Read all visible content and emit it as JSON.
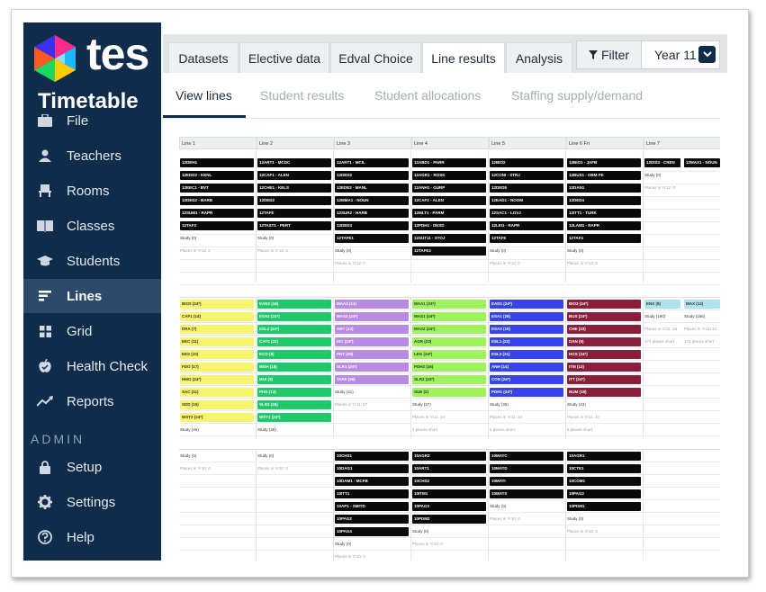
{
  "app": {
    "logo_text": "tes",
    "product": "Timetable"
  },
  "sidebar": {
    "items": [
      {
        "label": "File",
        "icon": "briefcase-icon"
      },
      {
        "label": "Teachers",
        "icon": "person-icon"
      },
      {
        "label": "Rooms",
        "icon": "chair-icon"
      },
      {
        "label": "Classes",
        "icon": "book-icon"
      },
      {
        "label": "Students",
        "icon": "graduation-cap-icon"
      },
      {
        "label": "Lines",
        "icon": "lines-icon"
      },
      {
        "label": "Grid",
        "icon": "grid-icon"
      },
      {
        "label": "Health Check",
        "icon": "apple-check-icon"
      },
      {
        "label": "Reports",
        "icon": "trend-icon"
      }
    ],
    "admin_label": "ADMIN",
    "admin_items": [
      {
        "label": "Setup",
        "icon": "lock-icon"
      },
      {
        "label": "Settings",
        "icon": "gear-icon"
      },
      {
        "label": "Help",
        "icon": "help-icon"
      }
    ]
  },
  "tabs": [
    "Datasets",
    "Elective data",
    "Edval Choice",
    "Line results",
    "Analysis"
  ],
  "active_tab": "Line results",
  "filter": {
    "label": "Filter",
    "year": "Year 11"
  },
  "subtabs": [
    "View lines",
    "Student results",
    "Student allocations",
    "Staffing supply/demand"
  ],
  "headers": [
    "Line 1",
    "Line 2",
    "Line 3",
    "Line 4",
    "Line 5",
    "Line 6  Fri",
    "Line 7"
  ],
  "colors": {
    "sidebar": "#102c4b",
    "black": "#0a0a0a",
    "yellow": "#f7f36a",
    "green": "#1dc96a",
    "purple": "#b98ae3",
    "lightgreen": "#9ef25c",
    "blue": "#3542ee",
    "maroon": "#8a1f3b",
    "cyan": "#aee3ed"
  },
  "block1": {
    "cols": [
      {
        "boxes": [
          "12DEH1",
          "12EDD2 - KENL",
          "12EEC1 - BVT",
          "12DED2 - BARB",
          "12SUM1 - RAPR",
          "12TAF3"
        ],
        "study": "Study (0)",
        "places": "Places in Yr12: 0"
      },
      {
        "boxes": [
          "12ART1 - MCDC",
          "12CAF1 - ALEN",
          "12CHE1 - KELS",
          "12DED2",
          "12TAFE",
          "12TAST1 - PERT"
        ],
        "study": "Study (0)",
        "places": "Places in Yr12: 0"
      },
      {
        "boxes": [
          "12ART1 - MCIL",
          "12DED2",
          "12EDE2 - MANL",
          "12MMA1 - NOUN",
          "12SUR2 - HARB",
          "12DED3",
          "12TAFE1"
        ],
        "study": "Study (0)",
        "places": "Places in Yr12: 0"
      },
      {
        "boxes": [
          "12ABD1 - PARR",
          "12AGR1 - ROSK",
          "12ANH1 - GURP",
          "12CAF2 - ALEN",
          "12MLT1 - PARM",
          "12PDH1 - DESD",
          "12SUT11 - STOJ",
          "12TAFE2"
        ],
        "study": "",
        "places": ""
      },
      {
        "boxes": [
          "12BIO2",
          "12CONI - STRJ",
          "12DED5",
          "12EAD1 - NOOM",
          "12SAC1 - LOVJ",
          "12LEI1 - RAPR",
          "12TAFE"
        ],
        "study": "Study (0)",
        "places": "Places in Yr12: 0"
      },
      {
        "boxes": [
          "12BIO1 - JAFB",
          "12BUS1 - OBM FE",
          "12DAN1",
          "12DED4",
          "12ITT1 - TURK",
          "12LAM1 - RAPR",
          "12TAF4"
        ],
        "study": "Study (0)",
        "places": "Places in Yr12: 0"
      },
      {
        "boxes": [
          "12DIS3 - CREN"
        ],
        "study": "Study (0)",
        "places": "Places in Yr12: 0"
      },
      {
        "boxes": [
          "12MAX1 - NOUN"
        ],
        "study": "",
        "places": ""
      }
    ]
  },
  "block2": {
    "cols": [
      {
        "color": "yel",
        "boxes": [
          "BIO2 (24*)",
          "CAF1 (14)",
          "DRA (7)",
          "EEC (11)",
          "EES (10)",
          "FDO (17)",
          "HMO (24*)",
          "SAC (11)",
          "SDD (10)",
          "WST2 (24*)"
        ],
        "study": "Study (46)",
        "places": ""
      },
      {
        "color": "grn",
        "boxes": [
          "EAD2 (18)",
          "ESA2 (24*)",
          "ESL2 (24*)",
          "CAF2 (22)",
          "ECO (9)",
          "MOH (18)",
          "MUI (3)",
          "PHD (12)",
          "SLR3 (28)",
          "WST1 (24*)"
        ],
        "study": "Study (28)",
        "places": ""
      },
      {
        "color": "pur",
        "boxes": [
          "MAA3 (14)",
          "MAS3 (24*)",
          "ART (13)",
          "ISC (24*)",
          "PHY (20)",
          "SLR1 (24*)",
          "TAFE (26)"
        ],
        "study": "Study (41)",
        "places": "Places in Yr11: 17"
      },
      {
        "color": "lgr",
        "boxes": [
          "MAA1 (24*)",
          "MAS1 (24*)",
          "MAS2 (24*)",
          "AGR (23)",
          "LEG (24*)",
          "PDH2 (16)",
          "SLR2 (24*)",
          "SUE (2)"
        ],
        "study": "Study (37)",
        "places": "Places in Yr11: 24",
        "short": "2 places short"
      },
      {
        "color": "blu",
        "boxes": [
          "EAD1 (24*)",
          "ESA1 (28)",
          "ESA3 (19)",
          "ESL1 (22)",
          "ESL3 (21)",
          "ANH (14)",
          "CON (24*)",
          "PDH1 (24*)"
        ],
        "study": "Study (30)",
        "places": "Places in Yr11: 24",
        "short": "6 places short"
      },
      {
        "color": "mar",
        "boxes": [
          "BIO3 (24*)",
          "BUS (24*)",
          "CHE (23)",
          "DAN (6)",
          "HOS (24*)",
          "ITM (13)",
          "ITT (24*)",
          "NUM (18)"
        ],
        "study": "Study (43)",
        "places": "Places in Yr11: 37",
        "short": "6 places short"
      },
      {
        "color": "cyn",
        "boxes": [
          "ENX (8)"
        ],
        "study": "Study (190)",
        "places": "Places in Yr11: 16",
        "short": "174 places short"
      },
      {
        "color": "cyn",
        "boxes": [
          "MAX (12)"
        ],
        "study": "Study (166)",
        "places": "Places in Yr11: 12",
        "short": "174 places short"
      }
    ]
  },
  "block3": {
    "cols": [
      {
        "boxes": [],
        "study": "Study (0)",
        "places": "Places in Yr10: 0"
      },
      {
        "boxes": [],
        "study": "Study (0)",
        "places": "Places in Yr10: 0"
      },
      {
        "boxes": [
          "10CHS1",
          "10DAG1",
          "10DAM1 - MCFB",
          "10ITT1",
          "10AP1 - SMITD",
          "10PAG2",
          "10PAG4"
        ],
        "study": "Study (0)",
        "places": "Places in Yr10: 0"
      },
      {
        "boxes": [
          "10AGR2",
          "10ART1",
          "10CHS2",
          "10ITM1",
          "10PAG3",
          "10PDM2"
        ],
        "study": "Study (0)",
        "places": "Places in Yr10: 0"
      },
      {
        "boxes": [
          "10MATC",
          "10MATD",
          "10MATI",
          "10MATS"
        ],
        "study": "Study (0)",
        "places": "Places in Yr10: 0"
      },
      {
        "boxes": [
          "10AGR1",
          "10CTE1",
          "10COM1",
          "10PAG2",
          "10PDM1"
        ],
        "study": "Study (0)",
        "places": "Places in Yr10: 0"
      },
      {
        "boxes": [],
        "study": "",
        "places": ""
      }
    ]
  }
}
